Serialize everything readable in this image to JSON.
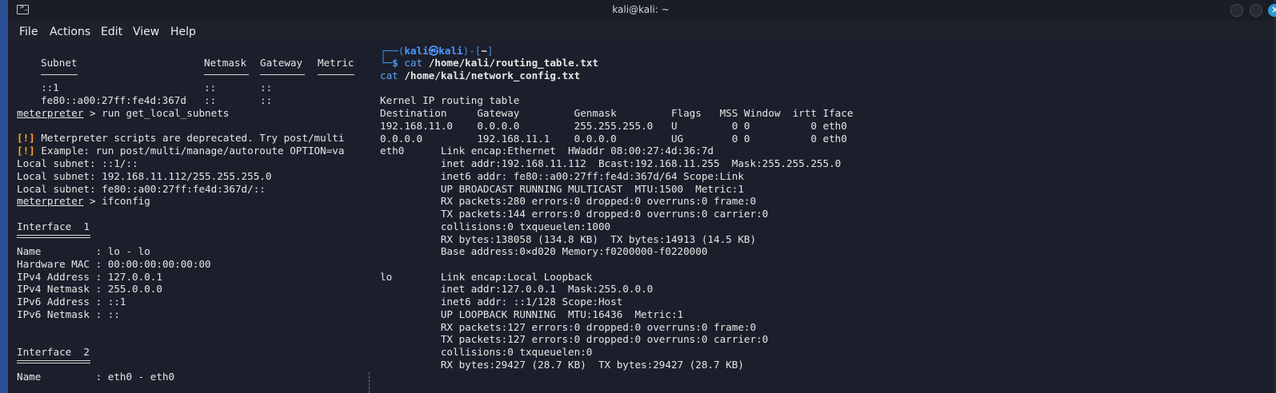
{
  "window": {
    "title": "kali@kali: ~",
    "close_glyph": "×",
    "icon": "terminal-icon"
  },
  "menu": [
    "File",
    "Actions",
    "Edit",
    "View",
    "Help"
  ],
  "left": {
    "headers": {
      "subnet": "Subnet",
      "netmask": "Netmask",
      "gateway": "Gateway",
      "metric": "Metric"
    },
    "routes": [
      {
        "subnet": "::1",
        "netmask": "::",
        "gateway": "::"
      },
      {
        "subnet": "fe80::a00:27ff:fe4d:367d",
        "netmask": "::",
        "gateway": "::"
      }
    ],
    "prompt": "meterpreter",
    "cmd1": " > run get_local_subnets",
    "warn_tag": "[!]",
    "warn1": " Meterpreter scripts are deprecated. Try post/multi",
    "warn2": " Example: run post/multi/manage/autoroute OPTION=va",
    "local_subnets": [
      "Local subnet: ::1/::",
      "Local subnet: 192.168.11.112/255.255.255.0",
      "Local subnet: fe80::a00:27ff:fe4d:367d/::"
    ],
    "cmd2": " > ifconfig",
    "iface1_title": "Interface  1",
    "iface1_lines": [
      "Name         : lo - lo",
      "Hardware MAC : 00:00:00:00:00:00",
      "IPv4 Address : 127.0.0.1",
      "IPv4 Netmask : 255.0.0.0",
      "IPv6 Address : ::1",
      "IPv6 Netmask : ::"
    ],
    "iface2_title": "Interface  2",
    "iface2_lines": [
      "Name         : eth0 - eth0"
    ]
  },
  "right": {
    "prompt_user": "kali",
    "prompt_at": "㉿",
    "prompt_host": "kali",
    "prompt_dir": "~",
    "cmd_word": "cat",
    "cmd1_arg": "/home/kali/routing_table.txt",
    "cmd2_arg": "/home/kali/network_config.txt",
    "output": [
      "Kernel IP routing table",
      "Destination     Gateway         Genmask         Flags   MSS Window  irtt Iface",
      "192.168.11.0    0.0.0.0         255.255.255.0   U         0 0          0 eth0",
      "0.0.0.0         192.168.11.1    0.0.0.0         UG        0 0          0 eth0",
      "eth0      Link encap:Ethernet  HWaddr 08:00:27:4d:36:7d",
      "          inet addr:192.168.11.112  Bcast:192.168.11.255  Mask:255.255.255.0",
      "          inet6 addr: fe80::a00:27ff:fe4d:367d/64 Scope:Link",
      "          UP BROADCAST RUNNING MULTICAST  MTU:1500  Metric:1",
      "          RX packets:280 errors:0 dropped:0 overruns:0 frame:0",
      "          TX packets:144 errors:0 dropped:0 overruns:0 carrier:0",
      "          collisions:0 txqueuelen:1000",
      "          RX bytes:138058 (134.8 KB)  TX bytes:14913 (14.5 KB)",
      "          Base address:0×d020 Memory:f0200000-f0220000",
      "",
      "lo        Link encap:Local Loopback",
      "          inet addr:127.0.0.1  Mask:255.0.0.0",
      "          inet6 addr: ::1/128 Scope:Host",
      "          UP LOOPBACK RUNNING  MTU:16436  Metric:1",
      "          RX packets:127 errors:0 dropped:0 overruns:0 frame:0",
      "          TX packets:127 errors:0 dropped:0 overruns:0 carrier:0",
      "          collisions:0 txqueuelen:0",
      "          RX bytes:29427 (28.7 KB)  TX bytes:29427 (28.7 KB)"
    ]
  }
}
